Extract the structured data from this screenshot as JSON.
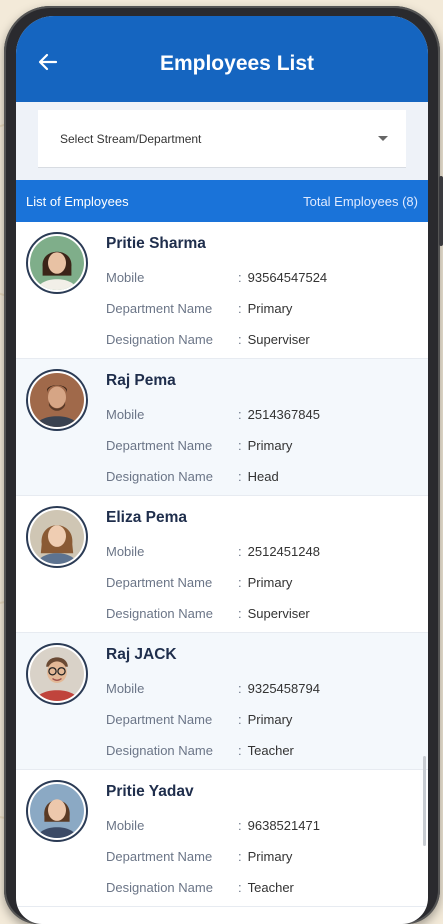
{
  "appbar": {
    "title": "Employees List"
  },
  "filter": {
    "placeholder": "Select Stream/Department"
  },
  "list_header": {
    "left": "List of Employees",
    "right": "Total Employees (8)"
  },
  "field_labels": {
    "mobile": "Mobile",
    "department": "Department Name",
    "designation": "Designation Name"
  },
  "employees": [
    {
      "name": "Pritie Sharma",
      "mobile": "93564547524",
      "department": "Primary",
      "designation": "Superviser"
    },
    {
      "name": "Raj Pema",
      "mobile": "2514367845",
      "department": "Primary",
      "designation": "Head"
    },
    {
      "name": "Eliza Pema",
      "mobile": "2512451248",
      "department": "Primary",
      "designation": "Superviser"
    },
    {
      "name": "Raj JACK",
      "mobile": "9325458794",
      "department": "Primary",
      "designation": "Teacher"
    },
    {
      "name": "Pritie Yadav",
      "mobile": "9638521471",
      "department": "Primary",
      "designation": "Teacher"
    }
  ],
  "colors": {
    "appbar": "#1565c0",
    "list_header": "#1a73d9",
    "name_text": "#1f2e4c"
  },
  "icons": {
    "back": "arrow-left-icon",
    "dropdown": "caret-down-icon"
  }
}
